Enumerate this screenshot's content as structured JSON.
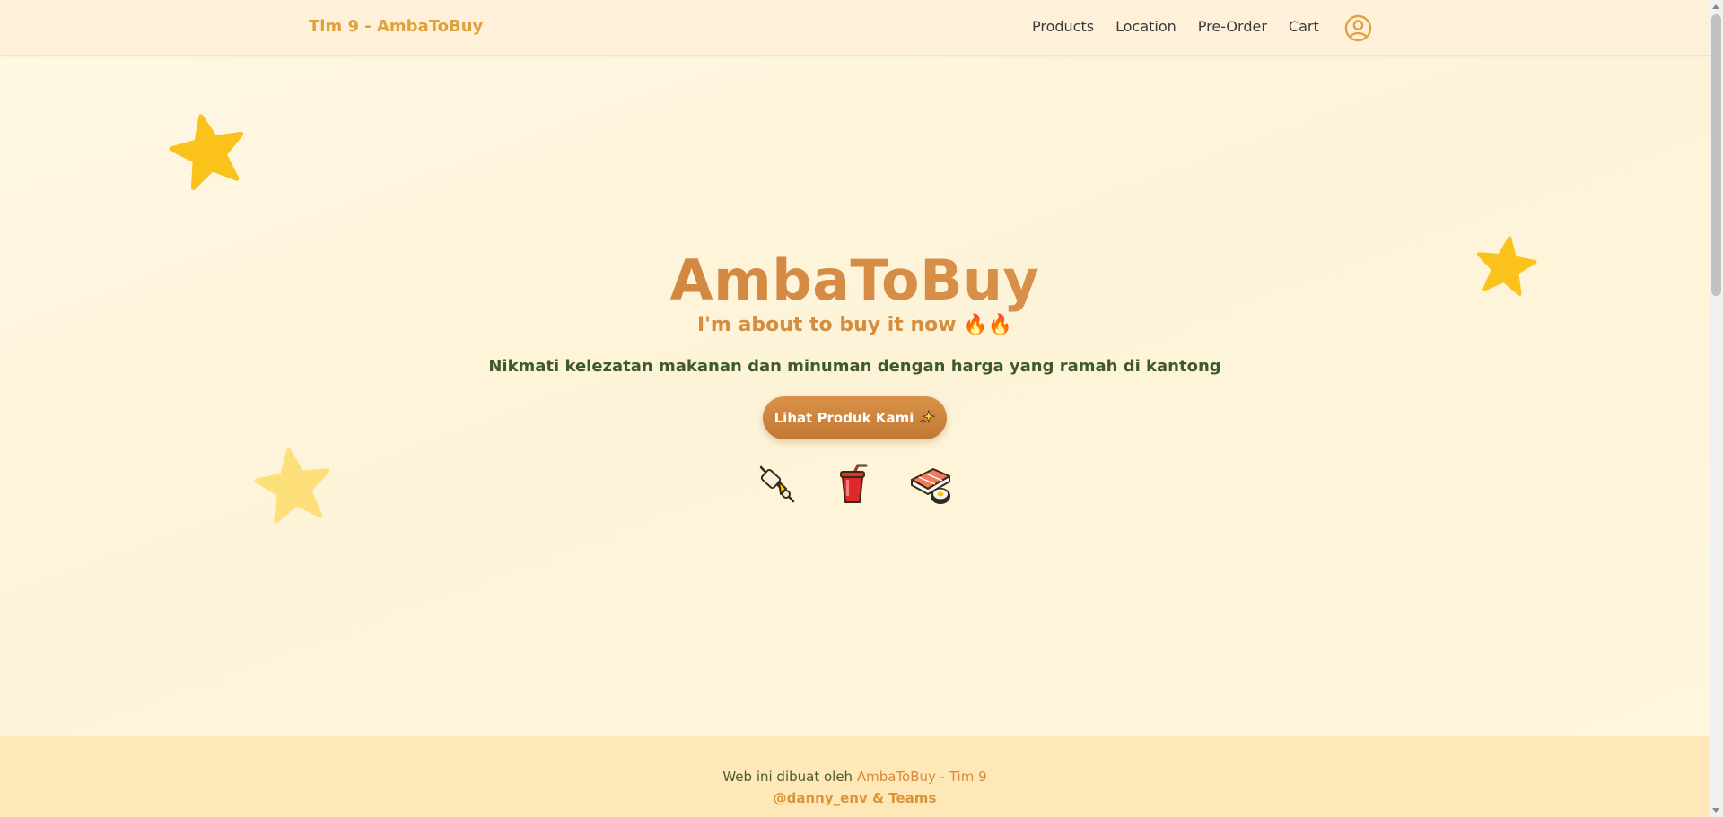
{
  "navbar": {
    "brand": "Tim 9 - AmbaToBuy",
    "links": [
      "Products",
      "Location",
      "Pre-Order",
      "Cart"
    ],
    "account_icon": "user-circle-icon"
  },
  "hero": {
    "title": "AmbaToBuy",
    "tagline": "I'm about to buy it now 🔥🔥",
    "description": "Nikmati kelezatan makanan dan minuman dengan harga yang ramah di kantong",
    "cta_label": "Lihat Produk Kami",
    "cta_icon": "sparkles-icon",
    "food_icons": [
      "oden-skewer-icon",
      "cup-with-straw-icon",
      "sushi-icon"
    ]
  },
  "decorations": {
    "stars": [
      "star-icon",
      "star-icon",
      "star-icon"
    ]
  },
  "footer": {
    "prefix": "Web ini dibuat oleh",
    "team": "AmbaToBuy - Tim 9",
    "credit": "@danny_env & Teams"
  },
  "colors": {
    "accent": "#d68c45",
    "brand": "#e0a03c",
    "text_green": "#3f5a2a",
    "background": "#fdf3d8",
    "footer_bg": "#ffe8b8"
  }
}
